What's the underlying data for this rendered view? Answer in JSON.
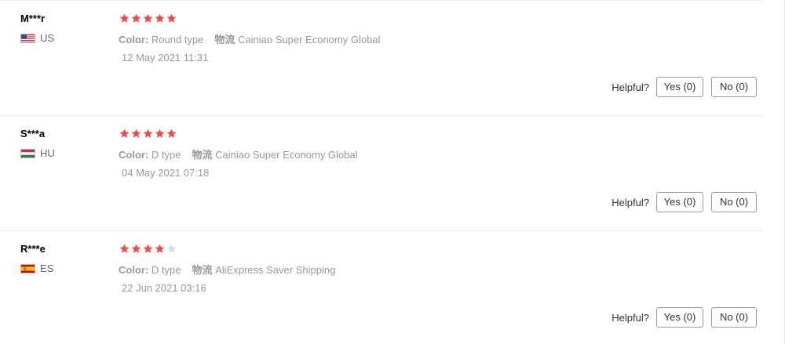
{
  "reviews": [
    {
      "user": "M***r",
      "country": "US",
      "flag": "us-flag",
      "rating": 5,
      "color_label": "Color:",
      "color_value": "Round type",
      "logistics_label": "物流",
      "logistics_value": "Cainiao Super Economy Global",
      "date": "12 May 2021 11:31",
      "helpful_label": "Helpful?",
      "yes_label": "Yes (0)",
      "no_label": "No (0)"
    },
    {
      "user": "S***a",
      "country": "HU",
      "flag": "hu-flag",
      "rating": 5,
      "color_label": "Color:",
      "color_value": "D type",
      "logistics_label": "物流",
      "logistics_value": "Cainiao Super Economy Global",
      "date": "04 May 2021 07:18",
      "helpful_label": "Helpful?",
      "yes_label": "Yes (0)",
      "no_label": "No (0)"
    },
    {
      "user": "R***e",
      "country": "ES",
      "flag": "es-flag",
      "rating": 4,
      "color_label": "Color:",
      "color_value": "D type",
      "logistics_label": "物流",
      "logistics_value": "AliExpress Saver Shipping",
      "date": "22 Jun 2021 03:16",
      "helpful_label": "Helpful?",
      "yes_label": "Yes (0)",
      "no_label": "No (0)"
    }
  ],
  "colors": {
    "star_filled": "#f44848",
    "star_empty": "#dddddd",
    "muted_text": "#999999",
    "button_border": "#999999"
  }
}
